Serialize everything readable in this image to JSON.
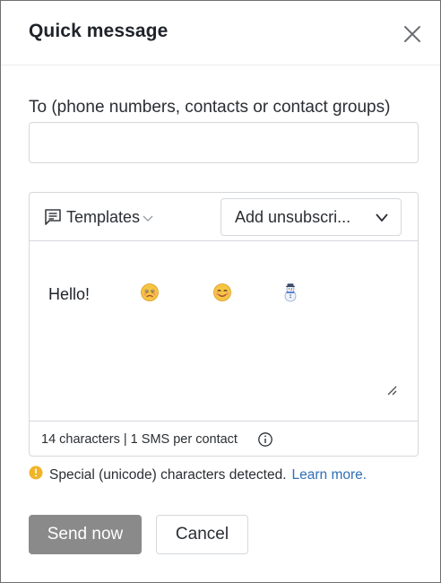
{
  "dialog": {
    "title": "Quick message",
    "close_icon": "close-icon"
  },
  "recipients": {
    "label": "To (phone numbers, contacts or contact groups)",
    "value": "",
    "placeholder": ""
  },
  "toolbar": {
    "templates_label": "Templates",
    "templates_icon": "message-square-icon",
    "unsubscribe_label": "Add unsubscri...",
    "chevron_icon": "chevron-down-icon"
  },
  "message": {
    "text": "Hello!",
    "emojis": [
      "frowning-face",
      "smiling-face",
      "snowman"
    ]
  },
  "counter": {
    "text": "14 characters | 1 SMS per contact",
    "info_icon": "info-icon"
  },
  "warning": {
    "text": "Special (unicode) characters detected.",
    "link": "Learn more.",
    "color": "#f0b429",
    "link_color": "#2f6fb5"
  },
  "actions": {
    "send_label": "Send now",
    "cancel_label": "Cancel",
    "send_color": "#8a8a8a"
  }
}
